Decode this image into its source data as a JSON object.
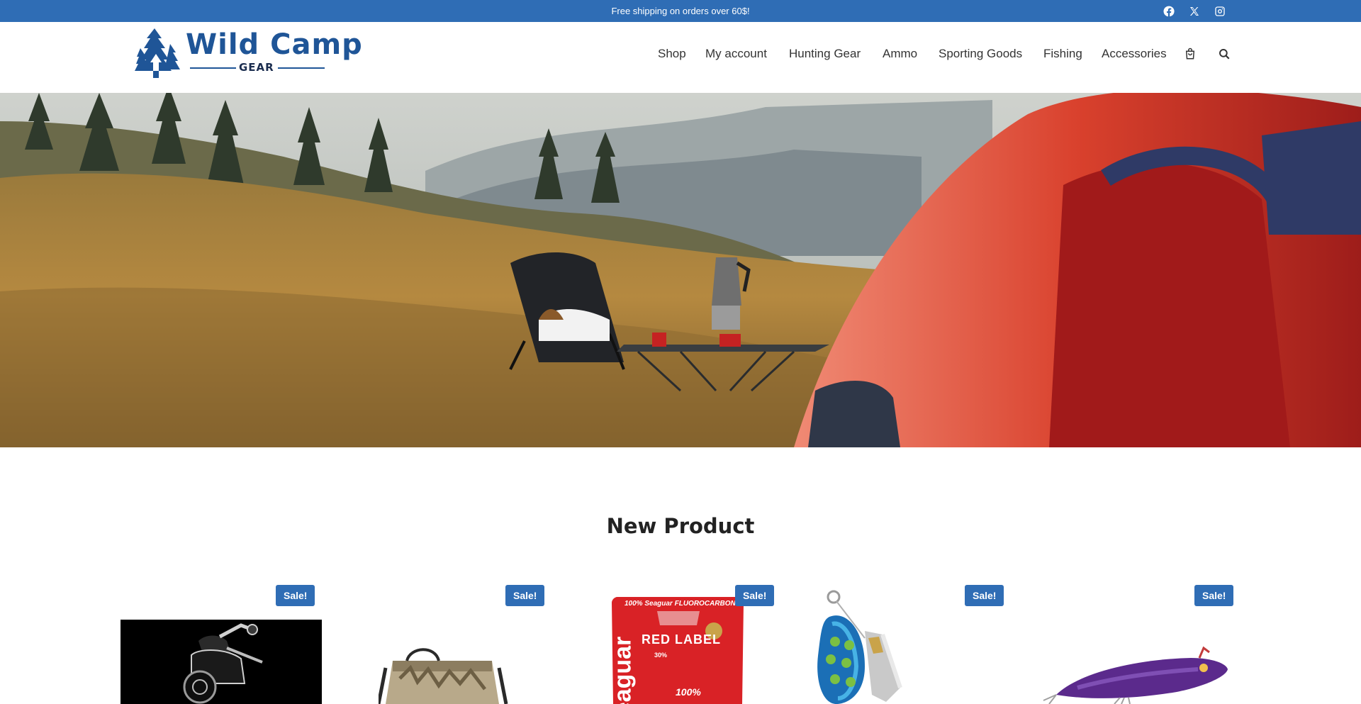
{
  "topbar": {
    "announcement": "Free shipping on orders over 60$!",
    "social": [
      "facebook-icon",
      "x-icon",
      "instagram-icon"
    ]
  },
  "brand": {
    "name": "Wild Camp",
    "sub": "GEAR",
    "color": "#1f5597"
  },
  "nav": {
    "items": [
      "Shop",
      "My account",
      "Hunting Gear",
      "Ammo",
      "Sporting Goods",
      "Fishing",
      "Accessories"
    ],
    "icons": [
      "cart-icon",
      "search-icon"
    ]
  },
  "section": {
    "title": "New Product"
  },
  "products": [
    {
      "badge": "Sale!",
      "image": "spinning-reel"
    },
    {
      "badge": "Sale!",
      "image": "camo-bag"
    },
    {
      "badge": "Sale!",
      "image": "fluorocarbon-line"
    },
    {
      "badge": "Sale!",
      "image": "spinner-lure"
    },
    {
      "badge": "Sale!",
      "image": "jerkbait-lure"
    }
  ],
  "product_package": {
    "brand_line": "100% Seaguar FLUOROCARBON",
    "label": "RED LABEL",
    "vertical": "eaguar",
    "pct_big": "100%",
    "pct_small": "30%"
  },
  "colors": {
    "accent": "#2f6db5",
    "text": "#333333"
  }
}
